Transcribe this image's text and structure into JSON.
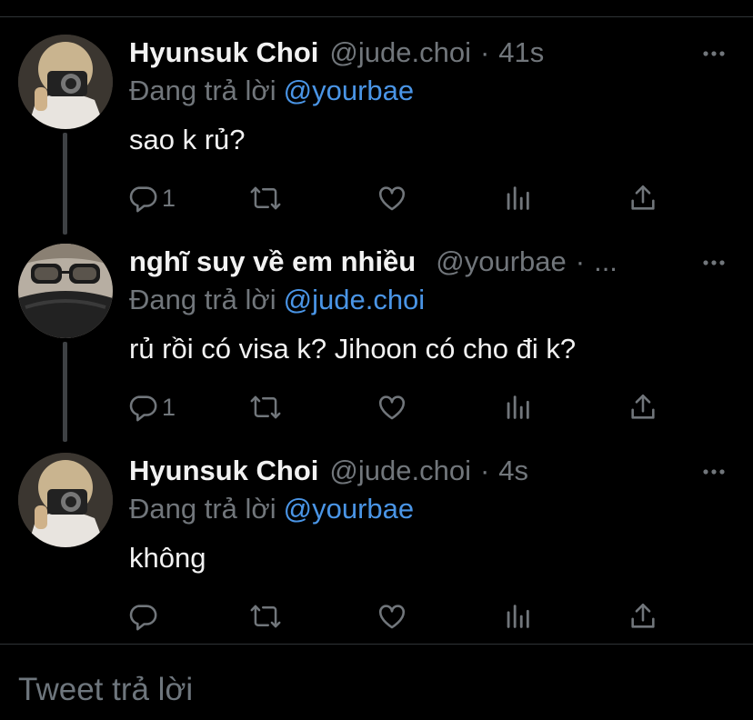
{
  "tweets": [
    {
      "name": "Hyunsuk Choi",
      "handle": "@jude.choi",
      "sep": "·",
      "time": "41s",
      "reply_prefix": "Đang trả lời",
      "reply_to": "@yourbae",
      "text": "sao k rủ?",
      "reply_count": "1"
    },
    {
      "name": "nghĩ suy về em nhiều",
      "handle": "@yourbae",
      "sep": "·",
      "time": "...",
      "reply_prefix": "Đang trả lời",
      "reply_to": "@jude.choi",
      "text": "rủ rồi có visa k? Jihoon có cho đi k?",
      "reply_count": "1"
    },
    {
      "name": "Hyunsuk Choi",
      "handle": "@jude.choi",
      "sep": "·",
      "time": "4s",
      "reply_prefix": "Đang trả lời",
      "reply_to": "@yourbae",
      "text": "không",
      "reply_count": ""
    }
  ],
  "composer": {
    "placeholder": "Tweet trả lời"
  },
  "icons": [
    "more-icon",
    "reply-icon",
    "retweet-icon",
    "like-icon",
    "analytics-icon",
    "share-icon"
  ],
  "colors": {
    "background": "#000000",
    "mention": "#4a95e6",
    "secondary_text": "#71767b",
    "thread_line": "#3e4144"
  }
}
